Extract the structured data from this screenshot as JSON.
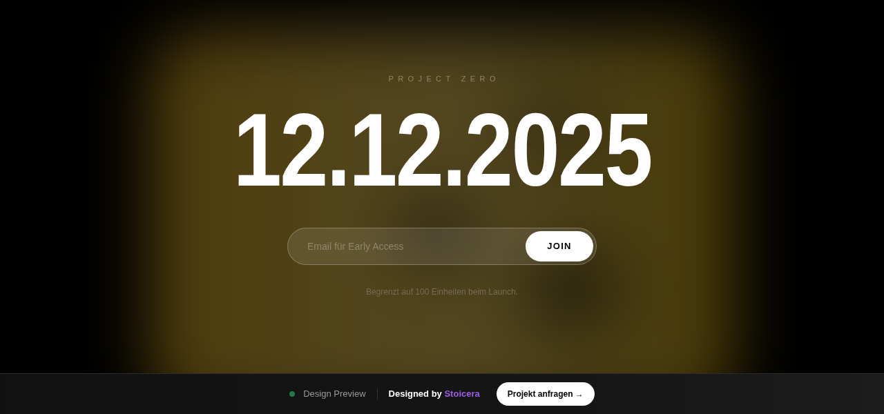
{
  "hero": {
    "eyebrow": "PROJECT ZERO",
    "date": "12.12.2025",
    "signup": {
      "placeholder": "Email für Early Access",
      "button": "JOIN"
    },
    "note": "Begrenzt auf 100 Einheiten beim Launch."
  },
  "footer": {
    "status": {
      "label": "Design Preview",
      "color": "#1f7a45"
    },
    "credit": {
      "text": "Designed by",
      "name": "Stoicera"
    },
    "button": "Projekt anfragen →"
  }
}
